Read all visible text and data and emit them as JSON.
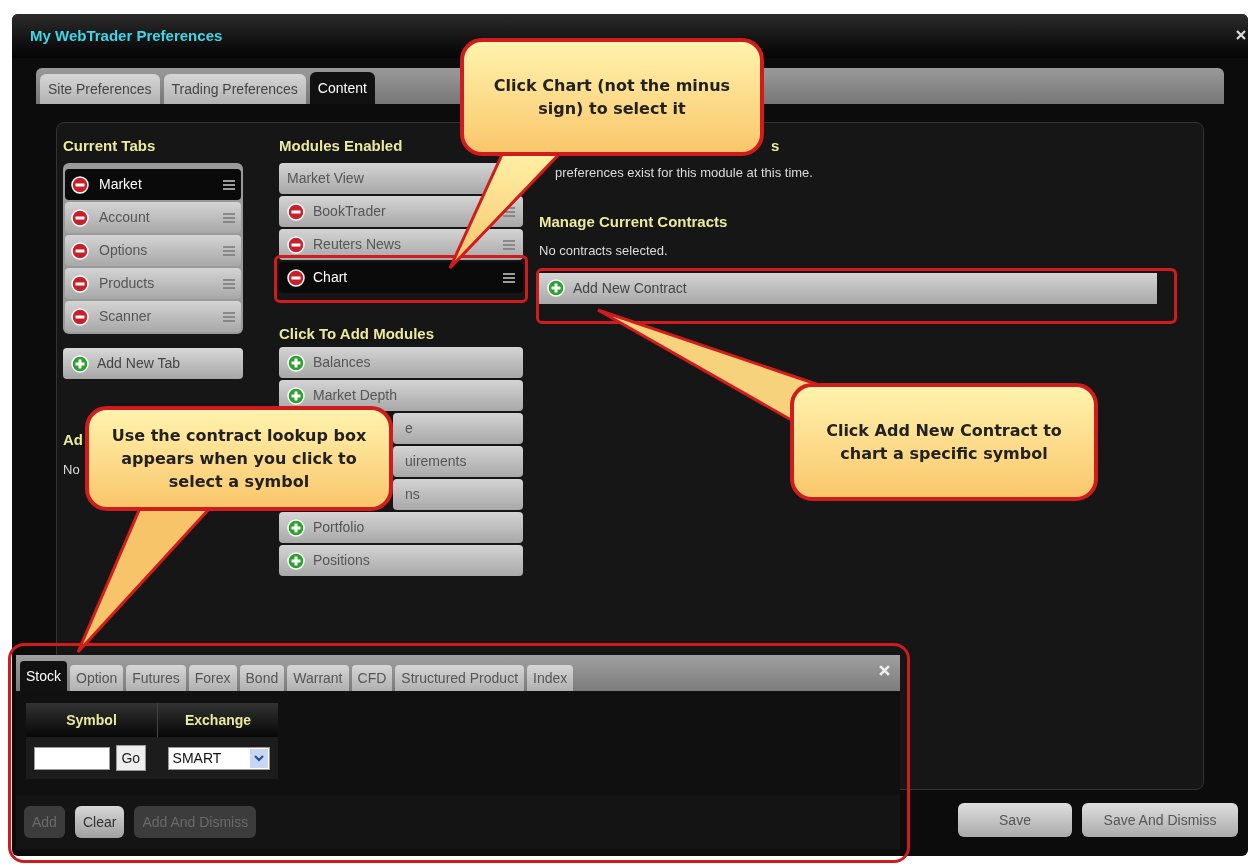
{
  "window": {
    "title": "My WebTrader Preferences"
  },
  "tabs": [
    {
      "label": "Site Preferences",
      "selected": false
    },
    {
      "label": "Trading Preferences",
      "selected": false
    },
    {
      "label": "Content",
      "selected": true
    }
  ],
  "current_tabs": {
    "heading": "Current Tabs",
    "items": [
      {
        "label": "Market",
        "selected": true
      },
      {
        "label": "Account",
        "selected": false
      },
      {
        "label": "Options",
        "selected": false
      },
      {
        "label": "Products",
        "selected": false
      },
      {
        "label": "Scanner",
        "selected": false
      }
    ],
    "add_button": "Add New Tab"
  },
  "covered_section": {
    "heading": "Ad",
    "text": "No"
  },
  "modules_enabled": {
    "heading": "Modules Enabled",
    "items": [
      {
        "label": "Market View",
        "kind": "plain",
        "selected": false
      },
      {
        "label": "BookTrader",
        "kind": "removable",
        "selected": false
      },
      {
        "label": "Reuters News",
        "kind": "removable",
        "selected": false
      },
      {
        "label": "Chart",
        "kind": "removable",
        "selected": true
      }
    ]
  },
  "add_modules": {
    "heading": "Click To Add Modules",
    "items": [
      {
        "label": "Balances",
        "kind": "addable"
      },
      {
        "label": "Market Depth",
        "kind": "addable"
      },
      {
        "label": "e",
        "kind": "covered"
      },
      {
        "label": "uirements",
        "kind": "covered"
      },
      {
        "label": "ns",
        "kind": "covered"
      },
      {
        "label": "Portfolio",
        "kind": "addable"
      },
      {
        "label": "Positions",
        "kind": "addable"
      }
    ]
  },
  "module_preferences": {
    "heading": "s",
    "text": "preferences exist for this module at this time."
  },
  "contracts": {
    "heading": "Manage Current Contracts",
    "text": "No contracts selected.",
    "add_button": "Add New Contract"
  },
  "footer_buttons": [
    "Save",
    "Save And Dismiss"
  ],
  "lookup": {
    "tabs": [
      {
        "label": "Stock",
        "selected": true
      },
      {
        "label": "Option",
        "selected": false
      },
      {
        "label": "Futures",
        "selected": false
      },
      {
        "label": "Forex",
        "selected": false
      },
      {
        "label": "Bond",
        "selected": false
      },
      {
        "label": "Warrant",
        "selected": false
      },
      {
        "label": "CFD",
        "selected": false
      },
      {
        "label": "Structured Product",
        "selected": false
      },
      {
        "label": "Index",
        "selected": false
      }
    ],
    "columns": [
      "Symbol",
      "Exchange"
    ],
    "go_button": "Go",
    "exchange": "SMART",
    "buttons": [
      {
        "label": "Add",
        "disabled": true
      },
      {
        "label": "Clear",
        "disabled": false
      },
      {
        "label": "Add And Dismiss",
        "disabled": true
      }
    ]
  },
  "callouts": [
    {
      "text": "Click Chart (not the minus sign) to select it"
    },
    {
      "text": "Use the contract lookup box appears when you click to select a symbol"
    },
    {
      "text": "Click Add New Contract to chart a specific symbol"
    }
  ]
}
